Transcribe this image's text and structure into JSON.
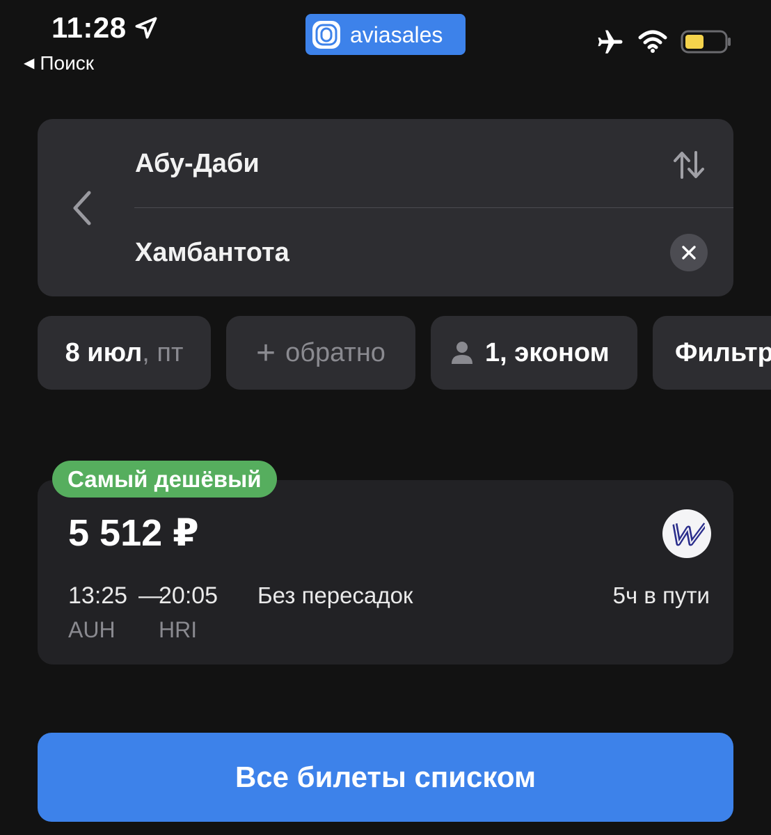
{
  "status_bar": {
    "time": "11:28",
    "back_label": "Поиск",
    "brand_name": "aviasales",
    "icons": [
      "location-arrow-icon",
      "airplane-mode-icon",
      "wifi-icon",
      "battery-icon"
    ],
    "battery_color": "#f4d34c"
  },
  "route": {
    "from": "Абу-Даби",
    "to": "Хамбантота"
  },
  "chips": {
    "date_main": "8 июл",
    "date_weekday": ", пт",
    "return_label": "обратно",
    "passengers": "1, эконом",
    "filters": "Фильтры"
  },
  "ticket": {
    "badge": "Самый дешёвый",
    "price": "5 512 ₽",
    "departure_time": "13:25",
    "separator": "—",
    "arrival_time": "20:05",
    "departure_code": "AUH",
    "arrival_code": "HRI",
    "stops": "Без пересадок",
    "duration": "5ч в пути",
    "badge_color": "#56ae5e"
  },
  "actions": {
    "all_tickets": "Все билеты списком"
  },
  "colors": {
    "accent": "#3d82ea",
    "background": "#121212",
    "card": "#2d2d31"
  }
}
